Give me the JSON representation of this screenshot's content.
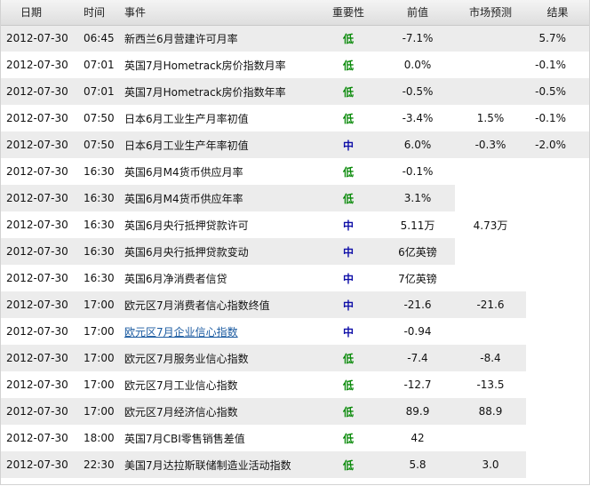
{
  "headers": {
    "date": "日期",
    "time": "时间",
    "event": "事件",
    "importance": "重要性",
    "previous": "前值",
    "forecast": "市场预测",
    "actual": "结果"
  },
  "colors": {
    "low": "#0a8a0a",
    "medium": "#1010a8",
    "link": "#1a5aa0",
    "row_alt": "#ececec"
  },
  "rows": [
    {
      "date": "2012-07-30",
      "time": "06:45",
      "event": "新西兰6月营建许可月率",
      "importance": "低",
      "level": "low",
      "previous": "-7.1%",
      "forecast": "",
      "actual": "5.7%",
      "link": false,
      "alt_cols": 7
    },
    {
      "date": "2012-07-30",
      "time": "07:01",
      "event": "英国7月Hometrack房价指数月率",
      "importance": "低",
      "level": "low",
      "previous": "0.0%",
      "forecast": "",
      "actual": "-0.1%",
      "link": false,
      "alt_cols": 7
    },
    {
      "date": "2012-07-30",
      "time": "07:01",
      "event": "英国7月Hometrack房价指数年率",
      "importance": "低",
      "level": "low",
      "previous": "-0.5%",
      "forecast": "",
      "actual": "-0.5%",
      "link": false,
      "alt_cols": 7
    },
    {
      "date": "2012-07-30",
      "time": "07:50",
      "event": "日本6月工业生产月率初值",
      "importance": "低",
      "level": "low",
      "previous": "-3.4%",
      "forecast": "1.5%",
      "actual": "-0.1%",
      "link": false,
      "alt_cols": 7
    },
    {
      "date": "2012-07-30",
      "time": "07:50",
      "event": "日本6月工业生产年率初值",
      "importance": "中",
      "level": "medium",
      "previous": "6.0%",
      "forecast": "-0.3%",
      "actual": "-2.0%",
      "link": false,
      "alt_cols": 7
    },
    {
      "date": "2012-07-30",
      "time": "16:30",
      "event": "英国6月M4货币供应月率",
      "importance": "低",
      "level": "low",
      "previous": "-0.1%",
      "forecast": "",
      "actual": "",
      "link": false,
      "alt_cols": 5
    },
    {
      "date": "2012-07-30",
      "time": "16:30",
      "event": "英国6月M4货币供应年率",
      "importance": "低",
      "level": "low",
      "previous": "3.1%",
      "forecast": "",
      "actual": "",
      "link": false,
      "alt_cols": 5
    },
    {
      "date": "2012-07-30",
      "time": "16:30",
      "event": "英国6月央行抵押贷款许可",
      "importance": "中",
      "level": "medium",
      "previous": "5.11万",
      "forecast": "4.73万",
      "actual": "",
      "link": false,
      "alt_cols": 6
    },
    {
      "date": "2012-07-30",
      "time": "16:30",
      "event": "英国6月央行抵押贷款变动",
      "importance": "中",
      "level": "medium",
      "previous": "6亿英镑",
      "forecast": "",
      "actual": "",
      "link": false,
      "alt_cols": 5
    },
    {
      "date": "2012-07-30",
      "time": "16:30",
      "event": "英国6月净消费者信贷",
      "importance": "中",
      "level": "medium",
      "previous": "7亿英镑",
      "forecast": "",
      "actual": "",
      "link": false,
      "alt_cols": 5
    },
    {
      "date": "2012-07-30",
      "time": "17:00",
      "event": "欧元区7月消费者信心指数终值",
      "importance": "中",
      "level": "medium",
      "previous": "-21.6",
      "forecast": "-21.6",
      "actual": "",
      "link": false,
      "alt_cols": 6
    },
    {
      "date": "2012-07-30",
      "time": "17:00",
      "event": "欧元区7月企业信心指数",
      "importance": "中",
      "level": "medium",
      "previous": "-0.94",
      "forecast": "",
      "actual": "",
      "link": true,
      "alt_cols": 5
    },
    {
      "date": "2012-07-30",
      "time": "17:00",
      "event": "欧元区7月服务业信心指数",
      "importance": "低",
      "level": "low",
      "previous": "-7.4",
      "forecast": "-8.4",
      "actual": "",
      "link": false,
      "alt_cols": 6
    },
    {
      "date": "2012-07-30",
      "time": "17:00",
      "event": "欧元区7月工业信心指数",
      "importance": "低",
      "level": "low",
      "previous": "-12.7",
      "forecast": "-13.5",
      "actual": "",
      "link": false,
      "alt_cols": 6
    },
    {
      "date": "2012-07-30",
      "time": "17:00",
      "event": "欧元区7月经济信心指数",
      "importance": "低",
      "level": "low",
      "previous": "89.9",
      "forecast": "88.9",
      "actual": "",
      "link": false,
      "alt_cols": 6
    },
    {
      "date": "2012-07-30",
      "time": "18:00",
      "event": "英国7月CBI零售销售差值",
      "importance": "低",
      "level": "low",
      "previous": "42",
      "forecast": "",
      "actual": "",
      "link": false,
      "alt_cols": 5
    },
    {
      "date": "2012-07-30",
      "time": "22:30",
      "event": "美国7月达拉斯联储制造业活动指数",
      "importance": "低",
      "level": "low",
      "previous": "5.8",
      "forecast": "3.0",
      "actual": "",
      "link": false,
      "alt_cols": 6
    }
  ]
}
